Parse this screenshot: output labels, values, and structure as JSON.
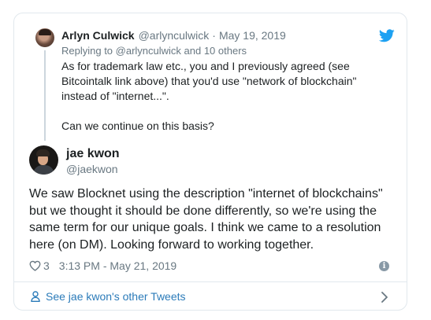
{
  "parent_tweet": {
    "name": "Arlyn Culwick",
    "handle": "@arlynculwick",
    "separator": "·",
    "date": "May 19, 2019",
    "replying_to": "Replying to @arlynculwick and 10 others",
    "text": "As for trademark law etc., you and I previously agreed (see\nBitcointalk link above) that you'd use \"network of blockchain\"\ninstead of \"internet...\".\n\nCan we continue on this basis?",
    "avatar_icon": "user-avatar-photo"
  },
  "main_tweet": {
    "name": "jae kwon",
    "handle": "@jaekwon",
    "text": "We saw Blocknet using the description \"internet of blockchains\" but we thought it should be done differently, so we're using the same term for our unique goals.  I think we came to a resolution here (on DM).  Looking forward to working together.",
    "likes": "3",
    "timestamp": "3:13 PM - May 21, 2019",
    "avatar_icon": "user-avatar-photo"
  },
  "footer": {
    "link_text": "See jae kwon's other Tweets"
  },
  "icons": {
    "brand": "twitter-bird-icon",
    "like": "heart-outline-icon",
    "info": "info-icon",
    "person": "person-icon",
    "chevron": "chevron-right-icon"
  },
  "colors": {
    "brand": "#1da1f2",
    "link": "#2b7bb9",
    "muted": "#697882",
    "text": "#1c2022",
    "border": "#e1e8ed"
  }
}
